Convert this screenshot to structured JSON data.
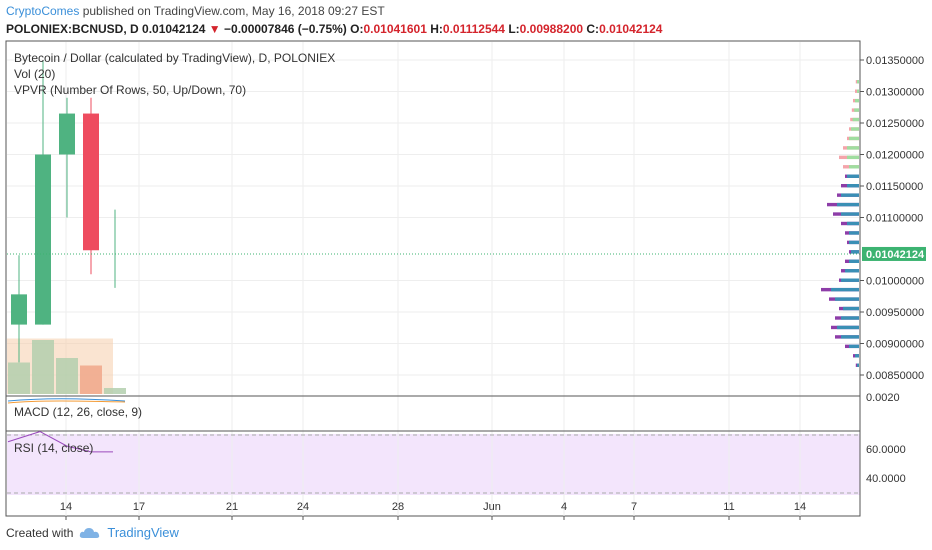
{
  "header": {
    "author": "CryptoComes",
    "published_text": " published on TradingView.com, May 16, 2018 09:27 EST",
    "symbol": "POLONIEX:BCNUSD, D",
    "last_price": "0.01042124",
    "change_arrow": "▼",
    "change": "−0.00007846 (−0.75%)",
    "o_label": "O:",
    "o_value": "0.01041601",
    "h_label": "H:",
    "h_value": "0.01112544",
    "l_label": "L:",
    "l_value": "0.00988200",
    "c_label": "C:",
    "c_value": "0.01042124"
  },
  "indicators": {
    "main_title": "Bytecoin / Dollar (calculated by TradingView), D, POLONIEX",
    "vol": "Vol (20)",
    "vpvr": "VPVR (Number Of Rows, 50, Up/Down, 70)",
    "macd": "MACD (12, 26, close, 9)",
    "rsi": "RSI (14, close)"
  },
  "price_axis": [
    "0.01350000",
    "0.01300000",
    "0.01250000",
    "0.01200000",
    "0.01150000",
    "0.01100000",
    "0.01000000",
    "0.00950000",
    "0.00900000",
    "0.00850000"
  ],
  "current_price_label": "0.01042124",
  "macd_axis": "0.0020",
  "rsi_axis": [
    "60.0000",
    "40.0000"
  ],
  "time_axis": [
    "14",
    "17",
    "21",
    "24",
    "28",
    "Jun",
    "4",
    "7",
    "11",
    "14"
  ],
  "footer": {
    "created_with": "Created with",
    "brand": "TradingView"
  },
  "colors": {
    "up": "#4fb381",
    "down": "#ee4c5f",
    "accent": "#3a8fd9",
    "rsi_bg": "#f3e5fc",
    "rsi_line": "#9a4bbd",
    "current_price": "#3cb371",
    "vpvr_up": "#3a8fb5",
    "vpvr_down": "#8d3da8",
    "vol_up": "#b3cfae",
    "vol_down": "#f0a789"
  },
  "chart_data": {
    "type": "candlestick",
    "symbol": "POLONIEX:BCNUSD",
    "interval": "D",
    "x_ticks": [
      "14",
      "17",
      "21",
      "24",
      "28",
      "Jun",
      "4",
      "7",
      "11",
      "14"
    ],
    "y_ticks": [
      0.0135,
      0.013,
      0.0125,
      0.012,
      0.0115,
      0.011,
      0.01,
      0.0095,
      0.009,
      0.0085
    ],
    "ylim": [
      0.0084,
      0.0138
    ],
    "current_price": 0.01042124,
    "candles": [
      {
        "day": "12",
        "open": 0.0093,
        "high": 0.0104,
        "low": 0.0087,
        "close": 0.00978
      },
      {
        "day": "13",
        "open": 0.0093,
        "high": 0.0135,
        "low": 0.0093,
        "close": 0.012
      },
      {
        "day": "14",
        "open": 0.012,
        "high": 0.0129,
        "low": 0.011,
        "close": 0.01265
      },
      {
        "day": "15",
        "open": 0.01265,
        "high": 0.0129,
        "low": 0.0101,
        "close": 0.01048
      },
      {
        "day": "16",
        "open": 0.01041601,
        "high": 0.01112544,
        "low": 0.009882,
        "close": 0.01042124
      }
    ],
    "volume_relative": [
      0.42,
      0.72,
      0.48,
      0.38,
      0.08
    ],
    "volume_ma_relative": 0.74,
    "rsi_ticks": [
      60,
      40
    ],
    "rsi_values": [
      65,
      72,
      62,
      58,
      58
    ],
    "vpvr_rows": [
      {
        "price": 0.01315,
        "up": 0.05,
        "down": 0.08
      },
      {
        "price": 0.013,
        "up": 0.05,
        "down": 0.1
      },
      {
        "price": 0.01285,
        "up": 0.1,
        "down": 0.15
      },
      {
        "price": 0.0127,
        "up": 0.12,
        "down": 0.18
      },
      {
        "price": 0.01255,
        "up": 0.16,
        "down": 0.22
      },
      {
        "price": 0.0124,
        "up": 0.2,
        "down": 0.25
      },
      {
        "price": 0.01225,
        "up": 0.25,
        "down": 0.3
      },
      {
        "price": 0.0121,
        "up": 0.3,
        "down": 0.4
      },
      {
        "price": 0.01195,
        "up": 0.3,
        "down": 0.5
      },
      {
        "price": 0.0118,
        "up": 0.25,
        "down": 0.4
      },
      {
        "price": 0.01165,
        "up": 0.3,
        "down": 0.35
      },
      {
        "price": 0.0115,
        "up": 0.3,
        "down": 0.45
      },
      {
        "price": 0.01135,
        "up": 0.45,
        "down": 0.55
      },
      {
        "price": 0.0112,
        "up": 0.55,
        "down": 0.8
      },
      {
        "price": 0.01105,
        "up": 0.45,
        "down": 0.65
      },
      {
        "price": 0.0109,
        "up": 0.3,
        "down": 0.45
      },
      {
        "price": 0.01075,
        "up": 0.25,
        "down": 0.35
      },
      {
        "price": 0.0106,
        "up": 0.25,
        "down": 0.3
      },
      {
        "price": 0.01045,
        "up": 0.2,
        "down": 0.25
      },
      {
        "price": 0.0103,
        "up": 0.25,
        "down": 0.35
      },
      {
        "price": 0.01015,
        "up": 0.35,
        "down": 0.45
      },
      {
        "price": 0.01,
        "up": 0.45,
        "down": 0.5
      },
      {
        "price": 0.00985,
        "up": 0.7,
        "down": 0.95
      },
      {
        "price": 0.0097,
        "up": 0.6,
        "down": 0.75
      },
      {
        "price": 0.00955,
        "up": 0.4,
        "down": 0.5
      },
      {
        "price": 0.0094,
        "up": 0.45,
        "down": 0.6
      },
      {
        "price": 0.00925,
        "up": 0.55,
        "down": 0.7
      },
      {
        "price": 0.0091,
        "up": 0.45,
        "down": 0.6
      },
      {
        "price": 0.00895,
        "up": 0.25,
        "down": 0.35
      },
      {
        "price": 0.0088,
        "up": 0.1,
        "down": 0.15
      },
      {
        "price": 0.00865,
        "up": 0.05,
        "down": 0.08
      }
    ]
  }
}
